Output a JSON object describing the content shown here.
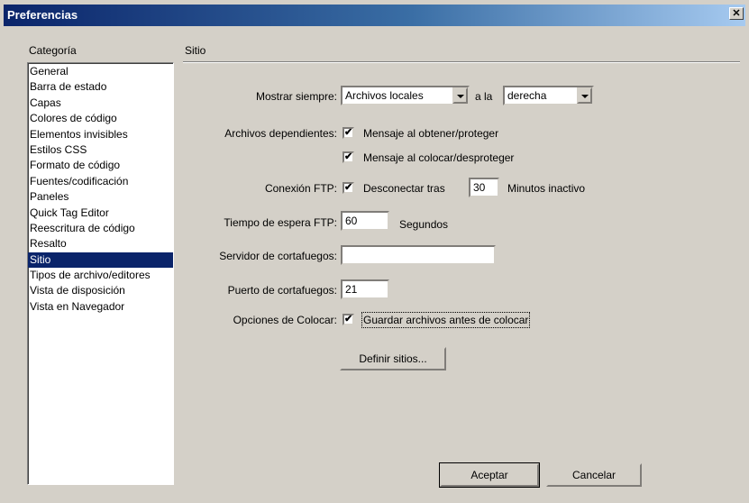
{
  "window": {
    "title": "Preferencias",
    "close_glyph": "✕"
  },
  "category": {
    "label": "Categoría",
    "items": [
      "General",
      "Barra de estado",
      "Capas",
      "Colores de código",
      "Elementos invisibles",
      "Estilos CSS",
      "Formato de código",
      "Fuentes/codificación",
      "Paneles",
      "Quick Tag Editor",
      "Reescritura de código",
      "Resalto",
      "Sitio",
      "Tipos de archivo/editores",
      "Vista de disposición",
      "Vista en Navegador"
    ],
    "selected": "Sitio"
  },
  "section": {
    "title": "Sitio"
  },
  "show_always": {
    "label": "Mostrar siempre:",
    "value": "Archivos locales",
    "middle": "a la",
    "side_value": "derecha"
  },
  "dependent_files": {
    "label": "Archivos dependientes:",
    "opt1": "Mensaje al obtener/proteger",
    "opt1_checked": true,
    "opt2": "Mensaje al colocar/desproteger",
    "opt2_checked": true
  },
  "ftp": {
    "label": "Conexión FTP:",
    "option": "Desconectar tras",
    "checked": true,
    "minutes": "30",
    "minutes_suffix": "Minutos inactivo"
  },
  "ftp_timeout": {
    "label": "Tiempo de espera FTP:",
    "value": "60",
    "suffix": "Segundos"
  },
  "firewall_server": {
    "label": "Servidor de cortafuegos:",
    "value": ""
  },
  "firewall_port": {
    "label": "Puerto de cortafuegos:",
    "value": "21"
  },
  "put_options": {
    "label": "Opciones de Colocar:",
    "option": "Guardar archivos antes de colocar",
    "checked": true
  },
  "buttons": {
    "define_sites": "Definir sitios...",
    "ok": "Aceptar",
    "cancel": "Cancelar"
  },
  "colors": {
    "title_start": "#0a246a",
    "title_end": "#a6caf0",
    "selection": "#0a246a",
    "face": "#d4d0c8"
  },
  "icons": {
    "close": "close-icon",
    "check": "check-icon",
    "dropdown": "chevron-down-icon"
  }
}
